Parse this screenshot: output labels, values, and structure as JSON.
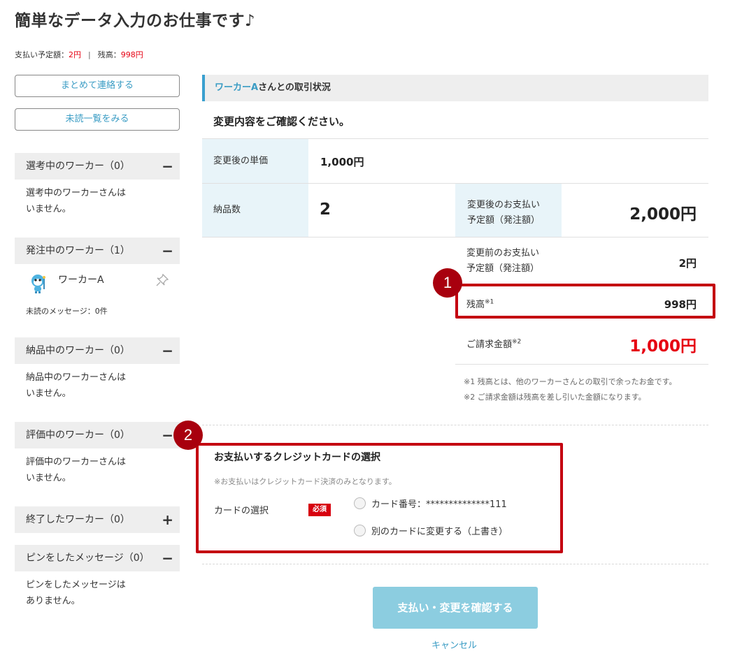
{
  "page": {
    "title": "簡単なデータ入力のお仕事です♪",
    "balance_line": {
      "scheduled_label": "支払い予定額：",
      "scheduled_value": "2円",
      "separator": "|",
      "balance_label": "残高：",
      "balance_value": "998円"
    }
  },
  "sidebar": {
    "contact_all_button": "まとめて連絡する",
    "unread_list_button": "未読一覧をみる",
    "sections": [
      {
        "label": "選考中のワーカー（0）",
        "toggle": "−",
        "text1": "選考中のワーカーさんは",
        "text2": "いません。"
      },
      {
        "label": "発注中のワーカー（1）",
        "toggle": "−",
        "worker_name": "ワーカーA",
        "unread": "未読のメッセージ：0件"
      },
      {
        "label": "納品中のワーカー（0）",
        "toggle": "−",
        "text1": "納品中のワーカーさんは",
        "text2": "いません。"
      },
      {
        "label": "評価中のワーカー（0）",
        "toggle": "−",
        "text1": "評価中のワーカーさんは",
        "text2": "いません。"
      },
      {
        "label": "終了したワーカー（0）",
        "toggle": "+"
      },
      {
        "label": "ピンをしたメッセージ（0）",
        "toggle": "−",
        "text1": "ピンをしたメッセージは",
        "text2": "ありません。"
      }
    ]
  },
  "main": {
    "header_worker": "ワーカーA",
    "header_rest": "さんとの取引状況",
    "confirm_text": "変更内容をご確認ください。",
    "unit_price_label": "変更後の単価",
    "unit_price_value": "1,000円",
    "quantity_label": "納品数",
    "quantity_value": "2",
    "after_payment_label1": "変更後のお支払い",
    "after_payment_label2": "予定額（発注額）",
    "after_payment_value": "2,000円",
    "before_payment_label1": "変更前のお支払い",
    "before_payment_label2": "予定額（発注額）",
    "before_payment_value": "2円",
    "balance_label": "残高",
    "balance_sup": "※1",
    "balance_value": "998円",
    "billing_label": "ご請求金額",
    "billing_sup": "※2",
    "billing_value": "1,000円",
    "note1": "※1 残高とは、他のワーカーさんとの取引で余ったお金です。",
    "note2": "※2 ご請求金額は残高を差し引いた金額になります。"
  },
  "card": {
    "title": "お支払いするクレジットカードの選択",
    "note": "※お支払いはクレジットカード決済のみとなります。",
    "select_label": "カードの選択",
    "required": "必須",
    "option1": "カード番号：**************111",
    "option2": "別のカードに変更する（上書き）"
  },
  "actions": {
    "submit": "支払い・変更を確認する",
    "cancel": "キャンセル"
  },
  "annotations": {
    "badge1": "1",
    "badge2": "2"
  },
  "colors": {
    "accent": "#3a9cc4",
    "alert_red": "#e60012",
    "annotation_red": "#c40010",
    "submit_bg": "#8ccde0"
  }
}
